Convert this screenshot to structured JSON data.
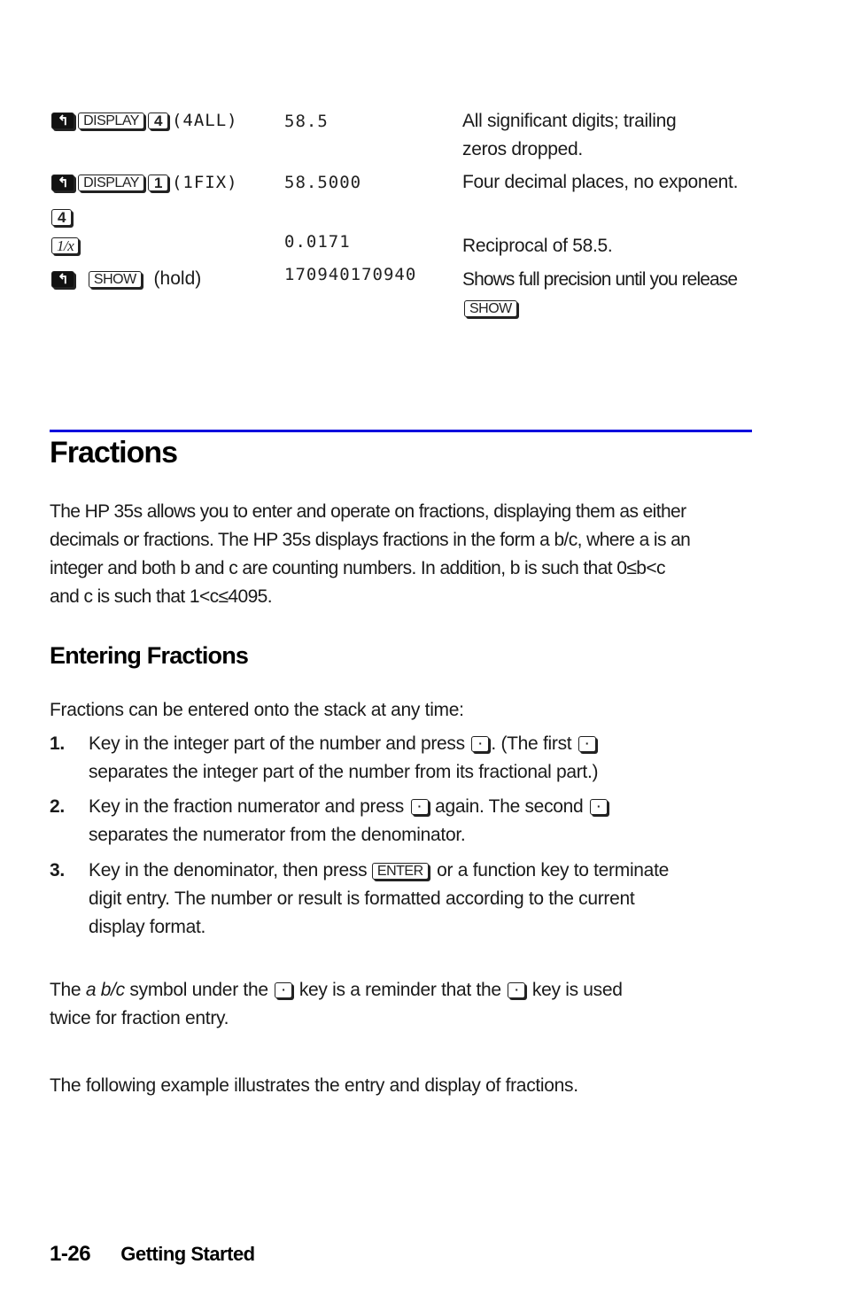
{
  "table_rows": [
    {
      "keys": [
        "shift-left",
        "DISPLAY",
        "4"
      ],
      "menu": "(4ALL)",
      "display": "58.5",
      "description_lines": [
        "All significant digits; trailing",
        "zeros dropped."
      ]
    },
    {
      "keys": [
        "shift-left",
        "DISPLAY",
        "1"
      ],
      "menu": "(1FIX)",
      "display": "58.5000",
      "description_lines": [
        "Four decimal places, no exponent."
      ]
    },
    {
      "keys": [
        "4"
      ],
      "display": "",
      "description_lines": []
    },
    {
      "keys": [
        "1/x"
      ],
      "display": "0.0171",
      "description_lines": [
        "Reciprocal of 58.5."
      ]
    },
    {
      "keys": [
        "shift-left",
        "SHOW"
      ],
      "suffix": "(hold)",
      "display": "170940170940",
      "description_lines": [
        "Shows full precision until you release"
      ],
      "description_key": "SHOW"
    }
  ],
  "section": {
    "title": "Fractions",
    "rule_color": "#0000dd",
    "intro_lines": [
      "The HP 35s allows you to enter and operate on fractions, displaying them as either",
      "decimals or fractions. The HP 35s displays fractions in the form a b/c, where a is an",
      "integer and both b and c are counting numbers. In addition, b is such that 0≤b<c",
      "and c is such that 1<c≤4095."
    ]
  },
  "subsection": {
    "title": "Entering Fractions",
    "lead": "Fractions can be entered onto the stack at any time:",
    "steps": [
      {
        "num": "1.",
        "line1_a": "Key in the integer part of the number and press",
        "line1_b": ". (The first",
        "line2": "separates the integer part of the number from its fractional part.)"
      },
      {
        "num": "2.",
        "line1_a": "Key in the fraction numerator and press",
        "line1_b": "again. The second",
        "line2": "separates the numerator from the denominator."
      },
      {
        "num": "3.",
        "line1_a": "Key in the denominator, then press",
        "key": "ENTER",
        "line1_b": "or a function key to terminate",
        "line2": "digit entry. The number or result is formatted according to the current",
        "line3": "display format."
      }
    ],
    "note": {
      "a": "The",
      "italic": "a b/c",
      "b": "symbol under the",
      "c": "key is a reminder that the",
      "d": "key is used",
      "line2": "twice for fraction entry."
    },
    "closing": "The following example illustrates the entry and display of fractions."
  },
  "keys": {
    "dot": "·",
    "shift": "↰"
  },
  "footer": {
    "page": "1-26",
    "chapter": "Getting Started"
  }
}
